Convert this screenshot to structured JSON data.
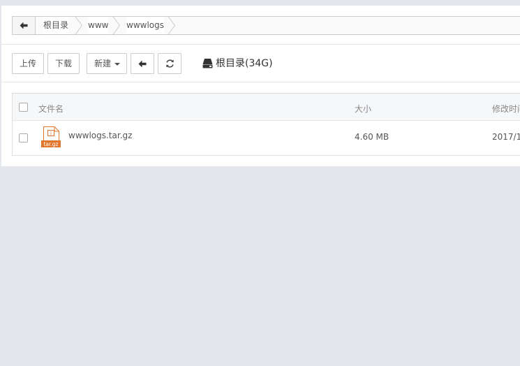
{
  "breadcrumb": {
    "items": [
      {
        "label": "根目录"
      },
      {
        "label": "www"
      },
      {
        "label": "wwwlogs"
      }
    ]
  },
  "toolbar": {
    "upload_label": "上传",
    "download_label": "下载",
    "new_label": "新建",
    "disk_label": "根目录(34G)"
  },
  "table": {
    "headers": {
      "name": "文件名",
      "size": "大小",
      "modified": "修改时间"
    },
    "rows": [
      {
        "name": "wwwlogs.tar.gz",
        "icon_badge": "tar.gz",
        "icon_glyph": "i",
        "size": "4.60 MB",
        "modified": "2017/1"
      }
    ]
  },
  "colors": {
    "background": "#e4e7ec",
    "archive_icon": "#e0772c"
  }
}
